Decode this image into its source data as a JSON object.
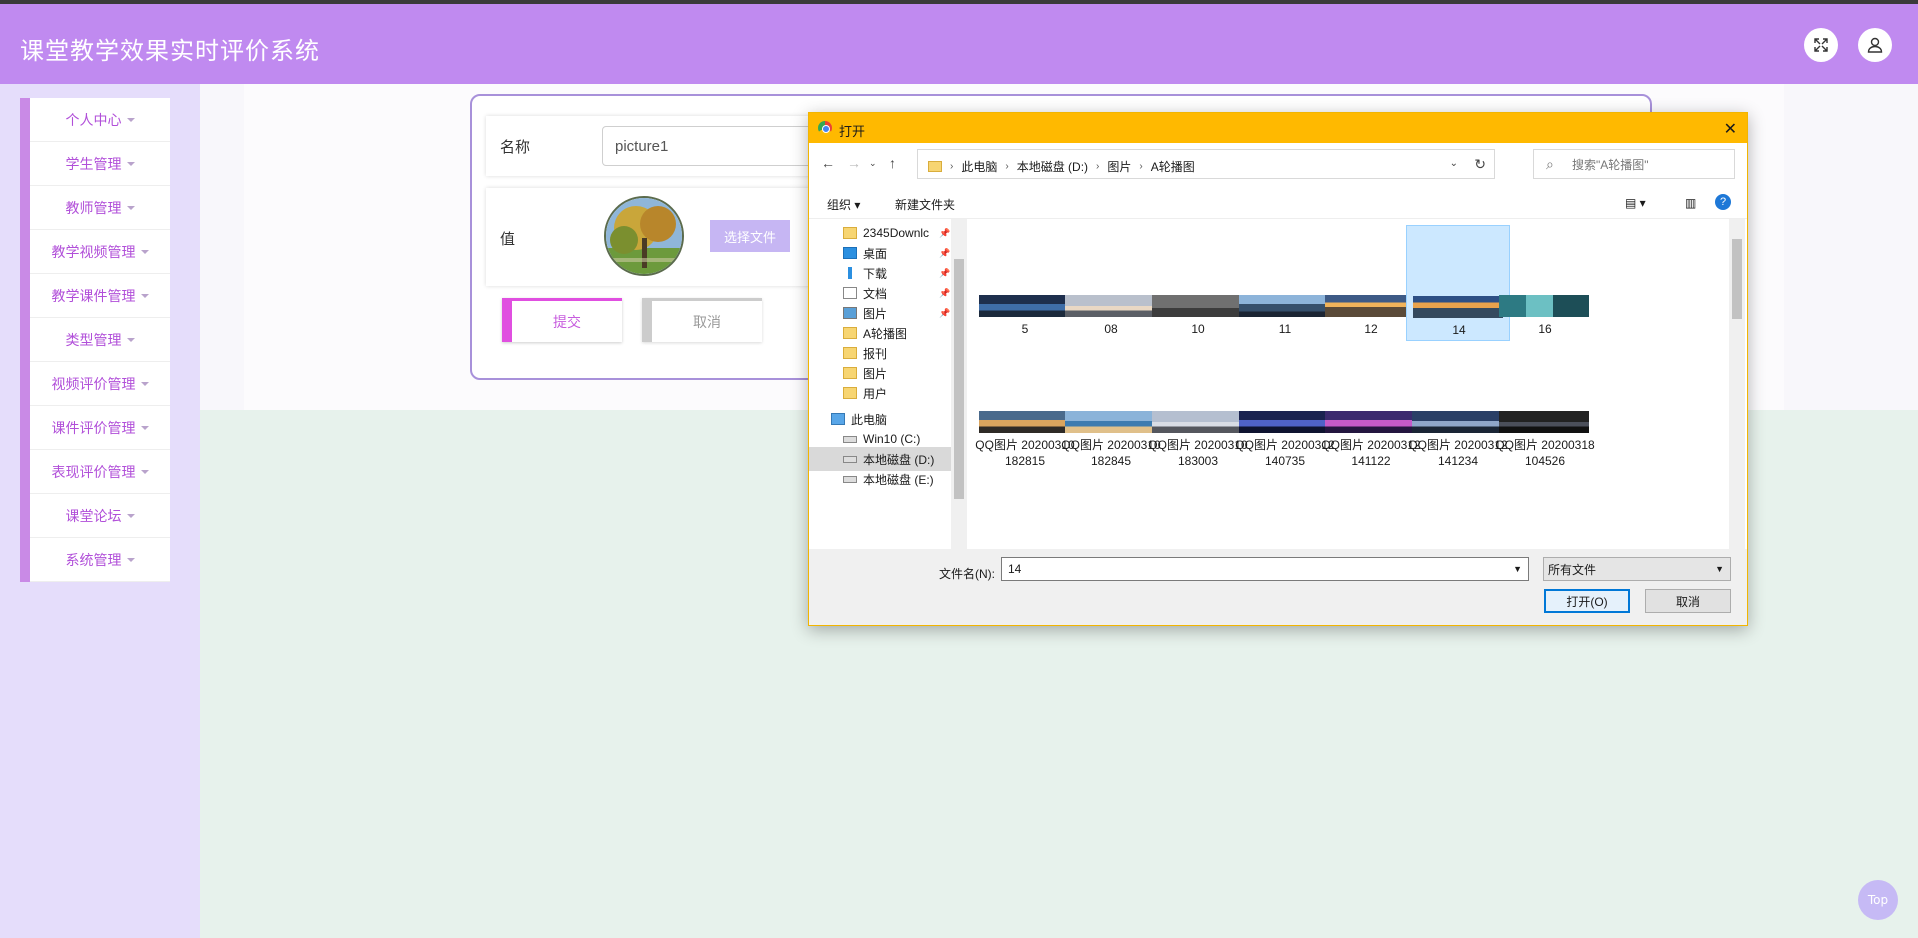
{
  "app": {
    "title": "课堂教学效果实时评价系统"
  },
  "header": {
    "fullscreen_icon": "expand-icon",
    "user_icon": "user-icon"
  },
  "sidebar": {
    "items": [
      {
        "label": "个人中心"
      },
      {
        "label": "学生管理"
      },
      {
        "label": "教师管理"
      },
      {
        "label": "教学视频管理"
      },
      {
        "label": "教学课件管理"
      },
      {
        "label": "类型管理"
      },
      {
        "label": "视频评价管理"
      },
      {
        "label": "课件评价管理"
      },
      {
        "label": "表现评价管理"
      },
      {
        "label": "课堂论坛"
      },
      {
        "label": "系统管理"
      }
    ]
  },
  "form": {
    "name_label": "名称",
    "name_value": "picture1",
    "value_label": "值",
    "choose_file": "选择文件",
    "submit": "提交",
    "cancel": "取消"
  },
  "dialog": {
    "title": "打开",
    "close": "✕",
    "breadcrumb": [
      "此电脑",
      "本地磁盘 (D:)",
      "图片",
      "A轮播图"
    ],
    "search_placeholder": "搜索\"A轮播图\"",
    "toolbar": {
      "organize": "组织 ▾",
      "new_folder": "新建文件夹"
    },
    "nav_items": [
      {
        "label": "2345Downlc",
        "icon": "folder",
        "pinned": true
      },
      {
        "label": "桌面",
        "icon": "desktop",
        "pinned": true
      },
      {
        "label": "下载",
        "icon": "download",
        "pinned": true
      },
      {
        "label": "文档",
        "icon": "document",
        "pinned": true
      },
      {
        "label": "图片",
        "icon": "pictures",
        "pinned": true
      },
      {
        "label": "A轮播图",
        "icon": "folder",
        "pinned": false
      },
      {
        "label": "报刊",
        "icon": "folder",
        "pinned": false
      },
      {
        "label": "图片",
        "icon": "folder",
        "pinned": false
      },
      {
        "label": "用户",
        "icon": "folder",
        "pinned": false
      },
      {
        "label": "此电脑",
        "icon": "computer",
        "pinned": false
      },
      {
        "label": "Win10 (C:)",
        "icon": "drive",
        "pinned": false
      },
      {
        "label": "本地磁盘 (D:)",
        "icon": "drive",
        "pinned": false,
        "selected": true
      },
      {
        "label": "本地磁盘 (E:)",
        "icon": "drive",
        "pinned": false
      }
    ],
    "files_row1": [
      {
        "name": "5"
      },
      {
        "name": "08"
      },
      {
        "name": "10"
      },
      {
        "name": "11"
      },
      {
        "name": "12"
      },
      {
        "name": "14",
        "selected": true
      },
      {
        "name": "16"
      }
    ],
    "files_row2": [
      {
        "name": "QQ图片 20200310182815"
      },
      {
        "name": "QQ图片 20200310182845"
      },
      {
        "name": "QQ图片 20200310183003"
      },
      {
        "name": "QQ图片 20200312140735"
      },
      {
        "name": "QQ图片 20200312141122"
      },
      {
        "name": "QQ图片 20200312141234"
      },
      {
        "name": "QQ图片 20200318104526"
      }
    ],
    "filename_label": "文件名(N):",
    "filename_value": "14",
    "filetype_value": "所有文件",
    "open_button": "打开(O)",
    "cancel_button": "取消"
  },
  "back_to_top": "Top",
  "colors": {
    "header": "#c08af0",
    "accent": "#b14fd9",
    "dialog_title": "#ffb900"
  }
}
